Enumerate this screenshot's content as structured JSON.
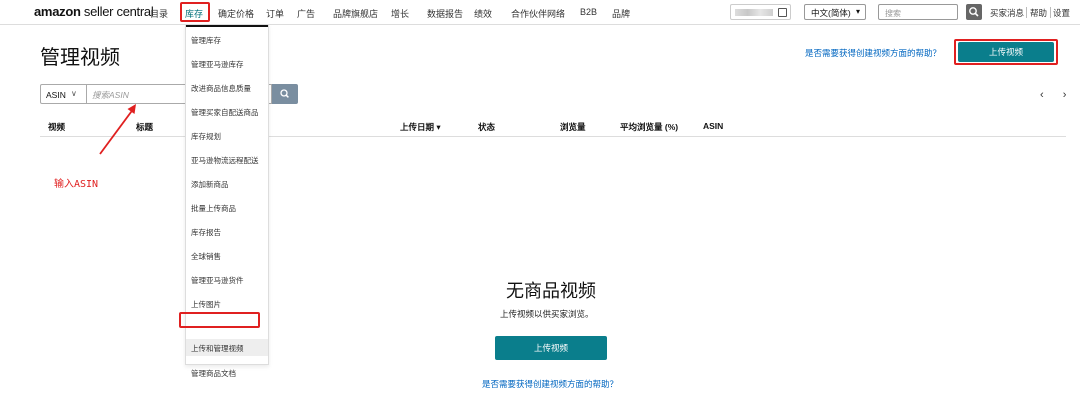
{
  "topnav": {
    "logo_bold": "amazon",
    "logo_rest": " seller central",
    "items": [
      "目录",
      "库存",
      "确定价格",
      "订单",
      "广告",
      "品牌旗舰店",
      "增长",
      "数据报告",
      "绩效",
      "合作伙伴网络",
      "B2B",
      "品牌"
    ],
    "language": "中文(简体)",
    "search_placeholder": "搜索",
    "links": [
      "买家消息",
      "帮助",
      "设置"
    ]
  },
  "page": {
    "title": "管理视频",
    "help_link": "是否需要获得创建视频方面的帮助？",
    "upload_button": "上传视频"
  },
  "search": {
    "field_type": "ASIN",
    "placeholder": "搜索ASIN",
    "pager": "‹ ›"
  },
  "table": {
    "columns": [
      "视频",
      "标题",
      "上传日期 ▾",
      "状态",
      "浏览量",
      "平均浏览量 (%)",
      "ASIN"
    ]
  },
  "inventory_menu": {
    "items": [
      "管理库存",
      "管理亚马逊库存",
      "改进商品信息质量",
      "管理买家自配送商品",
      "库存规划",
      "亚马逊物流远程配送",
      "添加新商品",
      "批量上传商品",
      "库存报告",
      "全球销售",
      "管理亚马逊货件",
      "上传图片",
      "上传和管理视频",
      "管理商品文档"
    ]
  },
  "empty_state": {
    "title": "无商品视频",
    "subtitle": "上传视频以供买家浏览。",
    "upload_button": "上传视频",
    "help_link": "是否需要获得创建视频方面的帮助？"
  },
  "annotation": {
    "label": "输入ASIN",
    "color": "#e02020"
  },
  "colors": {
    "accent": "#0a7e8c",
    "link": "#0066c0",
    "highlight": "#e02020"
  }
}
